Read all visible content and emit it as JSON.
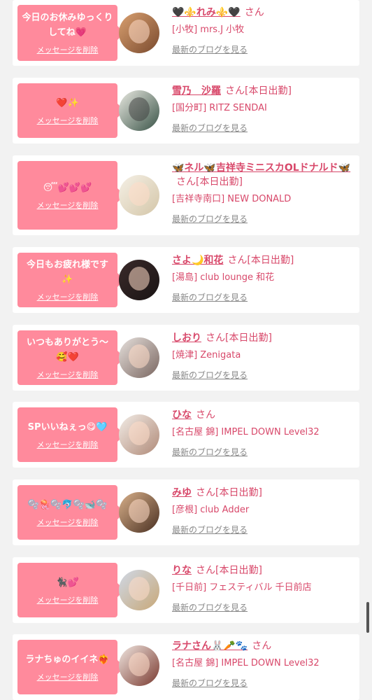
{
  "delete_label": "メッセージを削除",
  "blog_label": "最新のブログを見る",
  "colors": {
    "bubble": "#ff8a9c",
    "accent": "#d8486a",
    "background": "#f2f2f2"
  },
  "items": [
    {
      "message": "今日のお休みゆっくりしてね💗",
      "name": "🖤⚜️れみ⚜️🖤",
      "suffix": "さん",
      "shop": "[小牧] mrs.J 小牧"
    },
    {
      "message": "❤️✨",
      "name": "雪乃　沙羅",
      "suffix": "さん[本日出勤]",
      "shop": "[国分町] RITZ SENDAI"
    },
    {
      "message": "😴💕💕💕",
      "name": "🦋ネル🦋吉祥寺ミニスカOLドナルド🦋",
      "suffix": "さん[本日出勤]",
      "shop": "[吉祥寺南口] NEW DONALD"
    },
    {
      "message": "今日もお疲れ様です✨",
      "name": "さよ🌙和花",
      "suffix": "さん[本日出勤]",
      "shop": "[湯島] club lounge 和花"
    },
    {
      "message": "いつもありがとう〜🥰❤️",
      "name": "しおり",
      "suffix": "さん[本日出勤]",
      "shop": "[焼津] Zenigata"
    },
    {
      "message": "SPいいねぇっ😋🩵",
      "name": "ひな",
      "suffix": "さん",
      "shop": "[名古屋 錦] IMPEL DOWN Level32"
    },
    {
      "message": "🫧🪼🫧🐬🫧🐋🫧",
      "name": "みゆ",
      "suffix": "さん[本日出勤]",
      "shop": "[彦根] club Adder"
    },
    {
      "message": "🐈‍⬛💕",
      "name": "りな",
      "suffix": "さん[本日出勤]",
      "shop": "[千日前] フェスティバル 千日前店"
    },
    {
      "message": "ラナちゅのイイネ❤️‍🔥",
      "name": "ラナさん🐰🥕🐾",
      "suffix": "さん",
      "shop": "[名古屋 錦] IMPEL DOWN Level32"
    }
  ]
}
